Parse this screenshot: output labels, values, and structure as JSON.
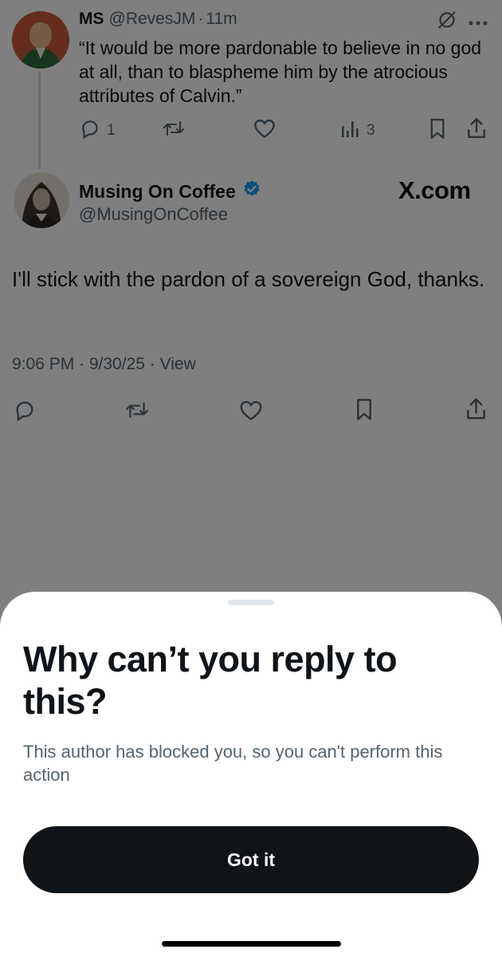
{
  "reply_tweet": {
    "display_name": "MS",
    "handle": "@RevesJM",
    "separator": "·",
    "time": "11m",
    "text": "“It would be more pardonable to believe in no god at all, than to blaspheme him by the atrocious attributes of Calvin.”",
    "actions": {
      "reply_count": "1",
      "views_count": "3"
    }
  },
  "main_tweet": {
    "display_name": "Musing On Coffee",
    "handle": "@MusingOnCoffee",
    "verified": true,
    "watermark": "X.com",
    "text": "I'll stick with the pardon of a sovereign God, thanks.",
    "meta": "9:06 PM · 9/30/25 · View"
  },
  "sheet": {
    "title": "Why can’t you reply to this?",
    "description": "This author has blocked you, so you can't perform this action",
    "button_label": "Got it"
  },
  "icons": {
    "reply": "reply-icon",
    "retweet": "retweet-icon",
    "like": "heart-icon",
    "views": "views-icon",
    "bookmark": "bookmark-icon",
    "share": "share-icon",
    "grok": "grok-icon",
    "more": "more-icon",
    "verified": "verified-badge-icon"
  },
  "colors": {
    "text_primary": "#0f1419",
    "text_secondary": "#536471",
    "verified_blue": "#1d9bf0",
    "button_bg": "#0f1419",
    "button_text": "#ffffff"
  }
}
